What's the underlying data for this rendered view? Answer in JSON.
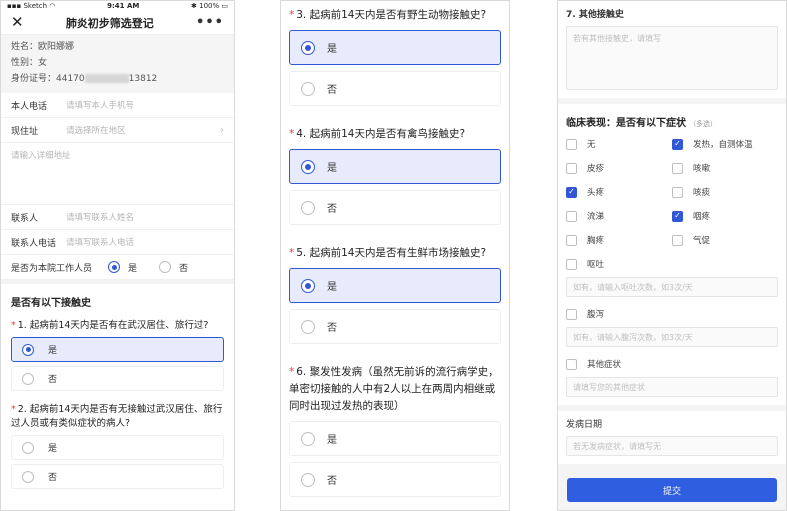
{
  "status_bar": {
    "carrier": "Sketch",
    "time": "9:41 AM",
    "battery": "100%"
  },
  "nav": {
    "title": "肺炎初步筛选登记"
  },
  "info": {
    "name": "姓名：欧阳娜娜",
    "gender": "性别：女",
    "id_prefix": "身份证号：44170",
    "id_suffix": "13812"
  },
  "form": {
    "phone_label": "本人电话",
    "phone_placeholder": "请填写本人手机号",
    "address_label": "现住址",
    "address_placeholder": "请选择所在地区",
    "detail_placeholder": "请输入详细地址",
    "contact_label": "联系人",
    "contact_placeholder": "请填写联系人姓名",
    "contact_phone_label": "联系人电话",
    "contact_phone_placeholder": "请填写联系人电话",
    "staff_label": "是否为本院工作人员",
    "yes": "是",
    "no": "否"
  },
  "exposure_section": "是否有以下接触史",
  "questions": [
    {
      "text": "1. 起病前14天内是否有在武汉居住、旅行过?",
      "yes": "是",
      "no": "否"
    },
    {
      "text": "2. 起病前14天内是否有无接触过武汉居住、旅行过人员或有类似症状的病人?",
      "yes": "是",
      "no": "否"
    },
    {
      "text": "3. 起病前14天内是否有野生动物接触史?",
      "yes": "是",
      "no": "否"
    },
    {
      "text": "4. 起病前14天内是否有禽鸟接触史?",
      "yes": "是",
      "no": "否"
    },
    {
      "text": "5. 起病前14天内是否有生鲜市场接触史?",
      "yes": "是",
      "no": "否"
    },
    {
      "text": "6. 聚发性发病（虽然无前诉的流行病学史，单密切接触的人中有2人以上在两周内相继或同时出现过发热的表现）",
      "yes": "是",
      "no": "否"
    },
    {
      "text": "7. 其他接触史",
      "placeholder": "若有其他接触史，请填写"
    }
  ],
  "symptoms": {
    "title": "临床表现：是否有以下症状",
    "hint": "（多选）",
    "items": [
      "无",
      "发热，自测体温",
      "皮疹",
      "咳嗽",
      "头疼",
      "咳痰",
      "流涕",
      "咽疼",
      "胸疼",
      "气促"
    ],
    "vomit": "呕吐",
    "vomit_placeholder": "如有，请输入呕吐次数，如3次/天",
    "diarrhea": "腹泻",
    "diarrhea_placeholder": "如有，请输入腹泻次数，如3次/天",
    "other": "其他症状",
    "other_placeholder": "请填写您的其他症状"
  },
  "onset": {
    "label": "发病日期",
    "placeholder": "若无发病症状，请填写无"
  },
  "submit": "提交",
  "colors": {
    "accent": "#3157d6",
    "button": "#2f5fe0",
    "selected_bg": "#e8ebfb",
    "required": "#e04343"
  }
}
